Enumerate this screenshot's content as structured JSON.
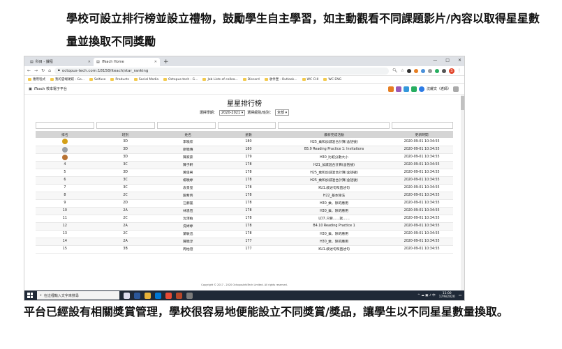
{
  "captions": {
    "top": "學校可設立排行榜並設立禮物，鼓勵學生自主學習，如主動觀看不同課題影片/內容以取得星星數量並換取不同獎勵",
    "bottom": "平台已經設有相關獎賞管理，學校很容易地便能設立不同獎賞/獎品，讓學生以不同星星數量換取。"
  },
  "browser": {
    "tabs": [
      {
        "label": "科目 - 課程",
        "active": false
      },
      {
        "label": "iTeach Home",
        "active": true
      }
    ],
    "url": "octopus-tech.com:18158/iteach/star_ranking",
    "bookmarks": [
      "應用程式",
      "我的雲端硬碟 - Go...",
      "Selfuse",
      "Products",
      "Social Media",
      "Octopus-tech - G...",
      "Job Lists of collea...",
      "Discord",
      "收件匣 - Outlook...",
      "WC CHI",
      "WC ENG"
    ]
  },
  "app": {
    "name": "iTeach 校本電子平台",
    "user": "沈耀文（老師）",
    "page_title": "星星排行榜",
    "filters": {
      "year_label": "選擇學期：",
      "year_value": "2020-2021",
      "class_label": "選擇級別/班別：",
      "class_value": "全部"
    },
    "table": {
      "headers": [
        "排名",
        "班別",
        "姓名",
        "星數",
        "最新完成活動",
        "更新時間"
      ],
      "rows": [
        {
          "rank": "",
          "medal": "#d4a017",
          "cls": "3D",
          "name": "李曉欣",
          "stars": "180",
          "activity": "H25_乘和加減混合計算(含括號)",
          "time": "2020-09-01 10:34:55"
        },
        {
          "rank": "",
          "medal": "#9aa0a6",
          "cls": "3D",
          "name": "廖曉傳",
          "stars": "180",
          "activity": "B5.9 Reading Practice 1: Invitations",
          "time": "2020-09-01 10:34:55"
        },
        {
          "rank": "",
          "medal": "#b87333",
          "cls": "3D",
          "name": "陳家豪",
          "stars": "179",
          "activity": "H30_比較分數大小",
          "time": "2020-09-01 10:34:55"
        },
        {
          "rank": "4",
          "medal": "",
          "cls": "3C",
          "name": "陳子軒",
          "stars": "178",
          "activity": "H21_加減混合計算(含括號)",
          "time": "2020-09-01 10:34:55"
        },
        {
          "rank": "5",
          "medal": "",
          "cls": "3D",
          "name": "黃俊男",
          "stars": "178",
          "activity": "H25_乘和加減混合計算(含括號)",
          "time": "2020-09-01 10:34:55"
        },
        {
          "rank": "6",
          "medal": "",
          "cls": "3C",
          "name": "楊曉婷",
          "stars": "178",
          "activity": "H25_乘和加減混合計算(含括號)",
          "time": "2020-09-01 10:34:55"
        },
        {
          "rank": "7",
          "medal": "",
          "cls": "3C",
          "name": "袁景瑩",
          "stars": "178",
          "activity": "KU1.敘述句和直述句",
          "time": "2020-09-01 10:34:55"
        },
        {
          "rank": "8",
          "medal": "",
          "cls": "2C",
          "name": "趙希齊",
          "stars": "178",
          "activity": "H22_基本除法",
          "time": "2020-09-01 10:34:55"
        },
        {
          "rank": "9",
          "medal": "",
          "cls": "2D",
          "name": "江靜嵐",
          "stars": "178",
          "activity": "H30_乘、除的應用",
          "time": "2020-09-01 10:34:55"
        },
        {
          "rank": "10",
          "medal": "",
          "cls": "2A",
          "name": "林思恆",
          "stars": "178",
          "activity": "H30_乘、除的應用",
          "time": "2020-09-01 10:34:55"
        },
        {
          "rank": "11",
          "medal": "",
          "cls": "2C",
          "name": "沈澤柏",
          "stars": "178",
          "activity": "LD7.只要……就……",
          "time": "2020-09-01 10:34:55"
        },
        {
          "rank": "12",
          "medal": "",
          "cls": "2A",
          "name": "洗婷婷",
          "stars": "178",
          "activity": "B4.10 Reading Practice 1",
          "time": "2020-09-01 10:34:55"
        },
        {
          "rank": "13",
          "medal": "",
          "cls": "2C",
          "name": "葉敏迅",
          "stars": "178",
          "activity": "H30_乘、除的應用",
          "time": "2020-09-01 10:34:55"
        },
        {
          "rank": "14",
          "medal": "",
          "cls": "2A",
          "name": "陳曉淳",
          "stars": "177",
          "activity": "H30_乘、除的應用",
          "time": "2020-09-01 10:34:55"
        },
        {
          "rank": "15",
          "medal": "",
          "cls": "3B",
          "name": "周柏澄",
          "stars": "177",
          "activity": "KU1.敘述句和直述句",
          "time": "2020-09-01 10:34:55"
        }
      ]
    },
    "footer": "Copyright © 2017 - 2020 OctopusInfoTech Limited. All rights reserved."
  },
  "taskbar": {
    "search_placeholder": "在這裡輸入文字來搜尋",
    "time": "11:00",
    "date": "17/9/2020"
  }
}
